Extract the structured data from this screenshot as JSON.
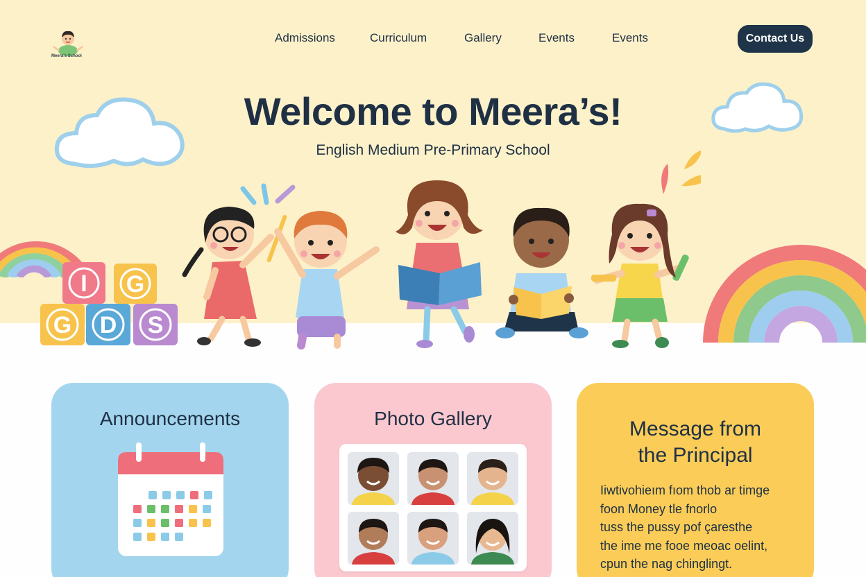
{
  "brand": {
    "logo_text": "Meera's School"
  },
  "nav": {
    "items": [
      {
        "label": "Admissions"
      },
      {
        "label": "Curriculum"
      },
      {
        "label": "Gallery"
      },
      {
        "label": "Events"
      },
      {
        "label": "Events"
      }
    ],
    "contact_label": "Contact Us"
  },
  "hero": {
    "title": "Welcome to Meera’s!",
    "subtitle": "English Medium Pre-Primary School",
    "blocks": [
      "I",
      "G",
      "G",
      "D",
      "S"
    ]
  },
  "cards": {
    "announcements": {
      "title": "Announcements"
    },
    "gallery": {
      "title": "Photo Gallery"
    },
    "principal": {
      "title_line1": "Message from",
      "title_line2": "the Principal",
      "body_lines": [
        "Iiwtivohieım fıom thob ar timge",
        "foon  Money tle fnorlo",
        "tuss the pussy pof çaresthe",
        "the ime me fooe meoac oelint,",
        "cpun the nag chinglingt."
      ]
    }
  },
  "colors": {
    "hero_bg": "#fdf1c9",
    "navy": "#1f3448",
    "card_blue": "#a3d6ee",
    "card_pink": "#fcc8d0",
    "card_yellow": "#fbcd58"
  }
}
